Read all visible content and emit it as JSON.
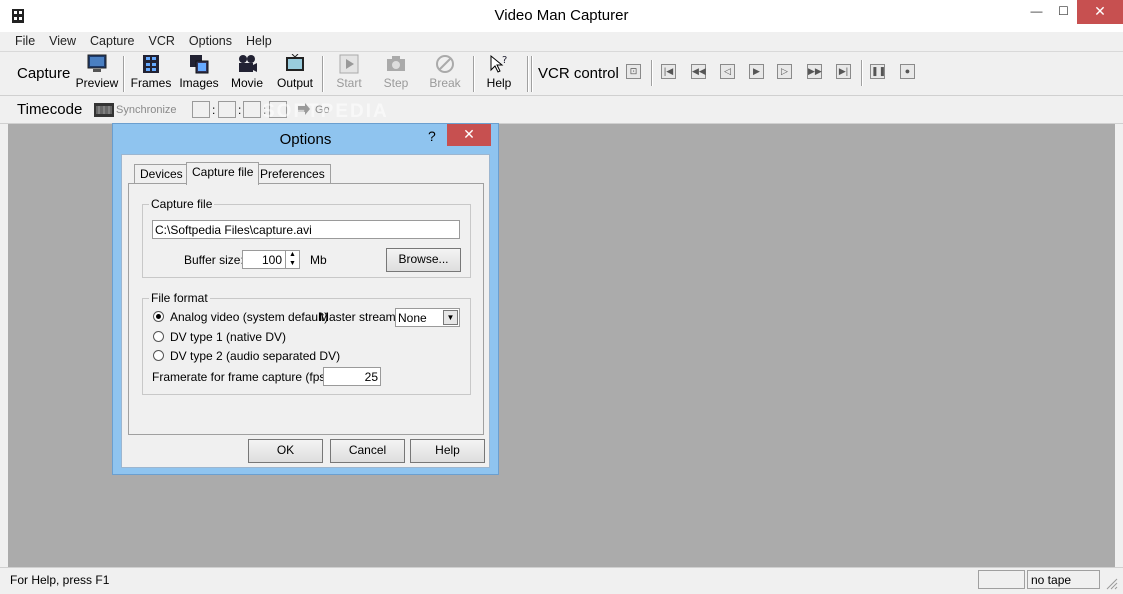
{
  "window": {
    "title": "Video Man Capturer",
    "icon": "film-reel-icon",
    "minimize": "—",
    "maximize": "☐",
    "close": "✕"
  },
  "menu": [
    "File",
    "View",
    "Capture",
    "VCR",
    "Options",
    "Help"
  ],
  "toolbar": {
    "capture_label": "Capture",
    "preview": "Preview",
    "frames": "Frames",
    "images": "Images",
    "movie": "Movie",
    "output": "Output",
    "start": "Start",
    "step": "Step",
    "break": "Break",
    "help": "Help",
    "vcr_label": "VCR control",
    "vcr_buttons": [
      "eject",
      "rewind-start",
      "rewind",
      "step-back",
      "play",
      "step-forward",
      "fast-forward",
      "forward-end",
      "pause",
      "record"
    ]
  },
  "timecode_bar": {
    "label": "Timecode",
    "synchronize": "Synchronize",
    "separator": ":",
    "go": "Go"
  },
  "dialog": {
    "title": "Options",
    "help_glyph": "?",
    "close_glyph": "✕",
    "tabs": [
      "Devices",
      "Capture file",
      "Preferences"
    ],
    "capture_group": "Capture file",
    "capture_path": "C:\\Softpedia Files\\capture.avi",
    "buffer_label": "Buffer size:",
    "buffer_value": "100",
    "buffer_unit": "Mb",
    "browse": "Browse...",
    "format_group": "File format",
    "radio_analog": "Analog video (system default)",
    "radio_dv1": "DV type 1 (native DV)",
    "radio_dv2": "DV type 2 (audio separated DV)",
    "master_label": "Master stream:",
    "master_value": "None",
    "framerate_label": "Framerate for frame capture (fps):",
    "framerate_value": "25",
    "ok": "OK",
    "cancel": "Cancel",
    "help": "Help"
  },
  "status": {
    "text": "For Help, press F1",
    "tape": "no tape"
  },
  "watermark": "SOFTPEDIA"
}
